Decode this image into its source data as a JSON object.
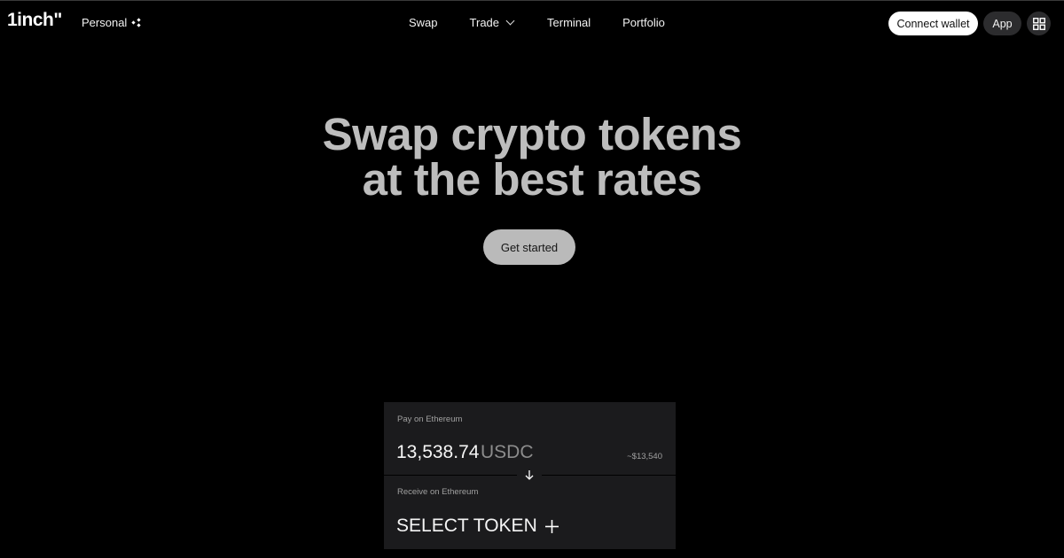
{
  "header": {
    "logo_text": "1inch\"",
    "workspace": {
      "label": "Personal",
      "icon": "dots-icon"
    },
    "nav": [
      {
        "label": "Swap"
      },
      {
        "label": "Trade",
        "icon": "chevron-down-icon"
      },
      {
        "label": "Terminal"
      },
      {
        "label": "Portfolio"
      }
    ],
    "connect_wallet_label": "Connect wallet",
    "app_label": "App",
    "grid_icon": "grid-icon"
  },
  "hero": {
    "title_line1": "Swap crypto tokens",
    "title_line2": "at the best rates",
    "cta_label": "Get started"
  },
  "swap": {
    "pay_label": "Pay on Ethereum",
    "pay_amount": "13,538.74",
    "pay_token": "USDC",
    "pay_usd": "~$13,540",
    "receive_label": "Receive on Ethereum",
    "select_token_label": "SELECT TOKEN"
  },
  "colors": {
    "background": "#000000",
    "panel": "#1b1b1d",
    "hero_text": "#bdbdbd",
    "cta_bg": "#bababa"
  }
}
